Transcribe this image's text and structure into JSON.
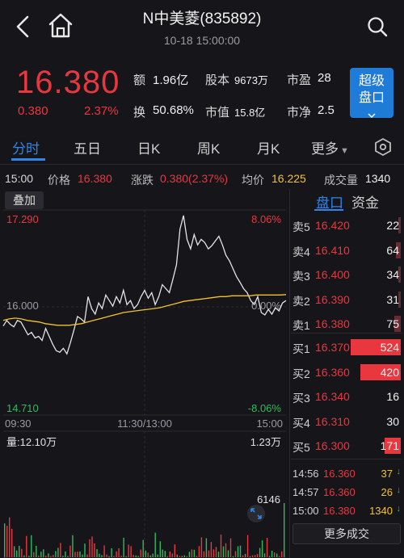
{
  "header": {
    "title": "N中美菱(835892)",
    "subtitle": "10-18 15:00:00"
  },
  "quote": {
    "price": "16.380",
    "change": "0.380",
    "change_pct": "2.37%",
    "stats": {
      "amount_label": "额",
      "amount": "1.96亿",
      "share_label": "股本",
      "share": "9673万",
      "pe_label": "市盈",
      "pe": "28",
      "turnover_label": "换",
      "turnover": "50.68%",
      "mcap_label": "市值",
      "mcap": "15.8亿",
      "pb_label": "市净",
      "pb": "2.5"
    },
    "advanced_button": [
      "超级",
      "盘口"
    ]
  },
  "tabs": [
    "分时",
    "五日",
    "日K",
    "周K",
    "月K",
    "更多"
  ],
  "info_row": {
    "time": "15:00",
    "price_label": "价格",
    "price": "16.380",
    "change_label": "涨跌",
    "change": "0.380(2.37%)",
    "avg_label": "均价",
    "avg": "16.225",
    "volume_label": "成交量",
    "volume": "1340"
  },
  "chart": {
    "overlay_button": "叠加",
    "top_price": "17.290",
    "top_pct": "8.06%",
    "mid_price": "16.000",
    "mid_pct": "0.00%",
    "bottom_price": "14.710",
    "bottom_pct": "-8.06%",
    "time_start": "09:30",
    "time_mid": "11:30/13:00",
    "time_end": "15:00",
    "volume_label": "量:12.10万",
    "volume_max": "1.23万",
    "volume_last": "6146"
  },
  "chart_data": {
    "type": "line",
    "ylim": [
      14.71,
      17.29
    ],
    "series": [
      {
        "values": [
          15.83,
          15.9,
          15.85,
          15.82,
          15.9,
          15.88,
          15.8,
          15.72,
          15.75,
          15.68,
          15.7,
          15.65,
          15.8,
          15.7,
          15.6,
          15.52,
          15.5,
          15.55,
          15.48,
          15.62,
          15.78,
          15.95,
          15.92,
          15.88,
          16.2,
          16.05,
          15.98,
          16.12,
          16.05,
          16.22,
          16.15,
          16.08,
          16.2,
          16.12,
          16.28,
          16.1,
          16.15,
          16.05,
          16.1,
          16.2,
          16.28,
          16.18,
          16.25,
          16.1,
          16.2,
          16.35,
          16.3,
          16.25,
          16.42,
          16.6,
          17.05,
          17.22,
          16.92,
          16.8,
          16.98,
          16.85,
          16.92,
          16.88,
          16.8,
          16.84,
          16.9,
          16.96,
          16.85,
          16.72,
          16.65,
          16.55,
          16.45,
          16.38,
          16.3,
          16.25,
          16.15,
          16.1,
          16.2,
          16.0,
          15.97,
          16.04,
          15.98,
          16.06,
          16.02,
          16.12,
          16.15
        ]
      },
      {
        "values": [
          15.9,
          15.92,
          15.93,
          15.92,
          15.9,
          15.89,
          15.88,
          15.86,
          15.85,
          15.84,
          15.84,
          15.84,
          15.85,
          15.86,
          15.88,
          15.9,
          15.92,
          15.94,
          15.96,
          15.98,
          16.0,
          16.01,
          16.02,
          16.03,
          16.04,
          16.05,
          16.06,
          16.08,
          16.1,
          16.12,
          16.14,
          16.15,
          16.16,
          16.17,
          16.18,
          16.19,
          16.2,
          16.2,
          16.21,
          16.21,
          16.21,
          16.21,
          16.22,
          16.22,
          16.22,
          16.22,
          16.22,
          16.225
        ]
      }
    ],
    "volume_range": [
      0,
      12300
    ]
  },
  "order_book": {
    "tab_active": "盘口",
    "tab_other": "资金",
    "asks": [
      {
        "label": "卖5",
        "price": "16.420",
        "volume": "22",
        "vol": 22
      },
      {
        "label": "卖4",
        "price": "16.410",
        "volume": "64",
        "vol": 64
      },
      {
        "label": "卖3",
        "price": "16.400",
        "volume": "34",
        "vol": 34
      },
      {
        "label": "卖2",
        "price": "16.390",
        "volume": "31",
        "vol": 31
      },
      {
        "label": "卖1",
        "price": "16.380",
        "volume": "75",
        "vol": 75
      }
    ],
    "bids": [
      {
        "label": "买1",
        "price": "16.370",
        "volume": "524",
        "vol": 524
      },
      {
        "label": "买2",
        "price": "16.360",
        "volume": "420",
        "vol": 420
      },
      {
        "label": "买3",
        "price": "16.340",
        "volume": "16",
        "vol": 16
      },
      {
        "label": "买4",
        "price": "16.310",
        "volume": "30",
        "vol": 30
      },
      {
        "label": "买5",
        "price": "16.300",
        "volume": "171",
        "vol": 171
      }
    ],
    "trades": [
      {
        "time": "14:56",
        "price": "16.360",
        "volume": "37",
        "dir": "down"
      },
      {
        "time": "14:57",
        "price": "16.360",
        "volume": "26",
        "dir": "down"
      },
      {
        "time": "15:00",
        "price": "16.380",
        "volume": "1340",
        "dir": "down"
      }
    ],
    "more_trades": "更多成交"
  },
  "colors": {
    "up": "#e8373f",
    "down": "#2dbb5c",
    "accent": "#2f86e8",
    "avg_line": "#f2c230"
  }
}
